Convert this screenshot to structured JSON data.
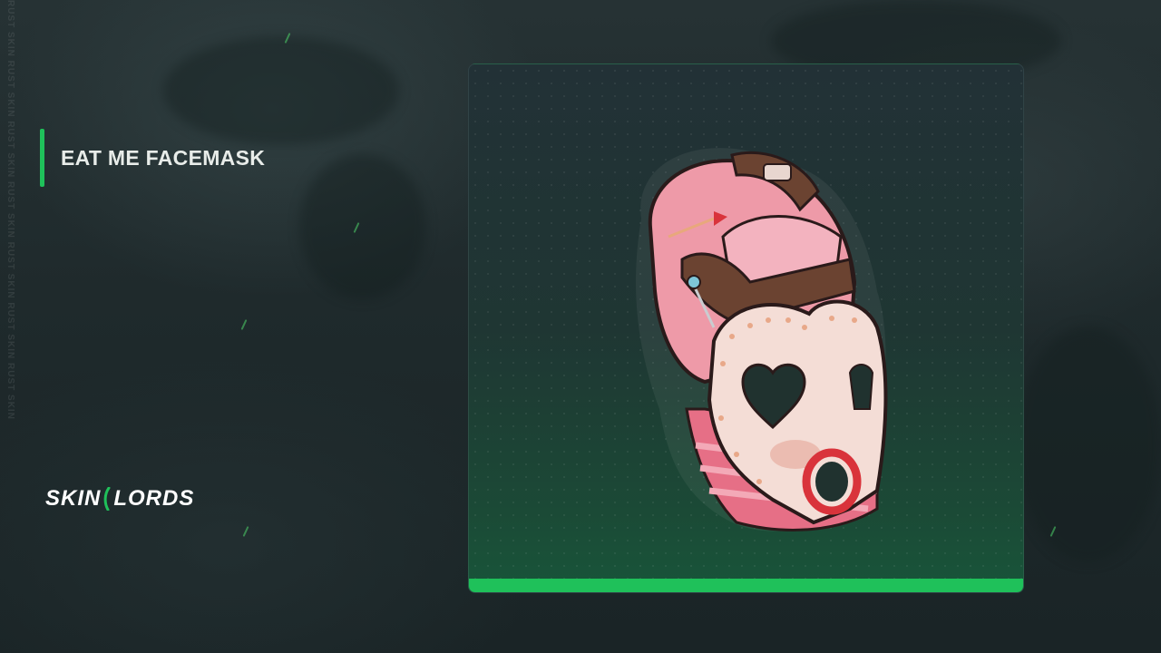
{
  "item": {
    "name": "EAT ME FACEMASK",
    "image": "eat-me-facemask-render"
  },
  "brand": {
    "logo_left": "SKIN",
    "logo_right": "LORDS",
    "accent": "#1fc15a"
  },
  "watermark": "RUST SKIN  RUST SKIN  RUST SKIN  RUST SKIN  RUST SKIN  RUST SKIN  RUST SKIN"
}
